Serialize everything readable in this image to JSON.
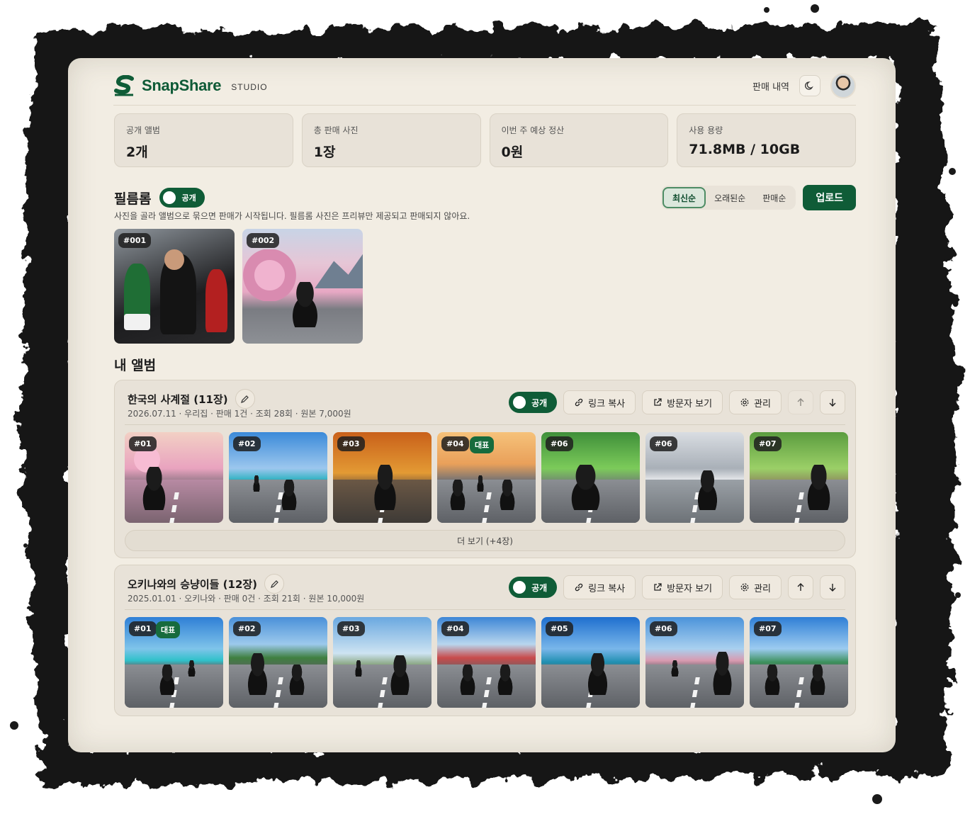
{
  "app": {
    "brand_name": "SnapShare",
    "brand_sub": "STUDIO",
    "sales_link": "판매 내역",
    "accent_color": "#0f5c37"
  },
  "stats": [
    {
      "label": "공개 앨범",
      "value": "2개"
    },
    {
      "label": "총 판매 사진",
      "value": "1장"
    },
    {
      "label": "이번 주 예상 정산",
      "value": "0원"
    },
    {
      "label": "사용 용량",
      "value": "71.8MB / 10GB"
    }
  ],
  "film": {
    "title": "필름롬",
    "toggle_label": "공개",
    "description": "사진을 골라 앨범으로 묶으면 판매가 시작됩니다. 필름롬 사진은 프리뷰만 제공되고 판매되지 않아요.",
    "sort": [
      "최신순",
      "오래된순",
      "판매순"
    ],
    "sort_active": "최신순",
    "upload_label": "업로드",
    "photos": [
      {
        "num": "#001"
      },
      {
        "num": "#002"
      }
    ]
  },
  "albums_title": "내 앨범",
  "albums": [
    {
      "title": "한국의 사계절 (11장)",
      "meta": "2026.07.11 · 우리집 · 판매 1건 · 조회 28회 · 원본 7,000원",
      "toggle_label": "공개",
      "copy_link": "링크 복사",
      "visitor_view": "방문자 보기",
      "manage": "관리",
      "more_label": "더 보기 (+4장)",
      "photos": [
        {
          "num": "#01",
          "rep": ""
        },
        {
          "num": "#02",
          "rep": ""
        },
        {
          "num": "#03",
          "rep": ""
        },
        {
          "num": "#04",
          "rep": "대표"
        },
        {
          "num": "#06",
          "rep": ""
        },
        {
          "num": "#06",
          "rep": ""
        },
        {
          "num": "#07",
          "rep": ""
        }
      ]
    },
    {
      "title": "오키나와의 승냥이들 (12장)",
      "meta": "2025.01.01 · 오키나와 · 판매 0건 · 조회 21회 · 원본 10,000원",
      "toggle_label": "공개",
      "copy_link": "링크 복사",
      "visitor_view": "방문자 보기",
      "manage": "관리",
      "photos": [
        {
          "num": "#01",
          "rep": "대표"
        },
        {
          "num": "#02",
          "rep": ""
        },
        {
          "num": "#03",
          "rep": ""
        },
        {
          "num": "#04",
          "rep": ""
        },
        {
          "num": "#05",
          "rep": ""
        },
        {
          "num": "#06",
          "rep": ""
        },
        {
          "num": "#07",
          "rep": ""
        }
      ]
    }
  ]
}
